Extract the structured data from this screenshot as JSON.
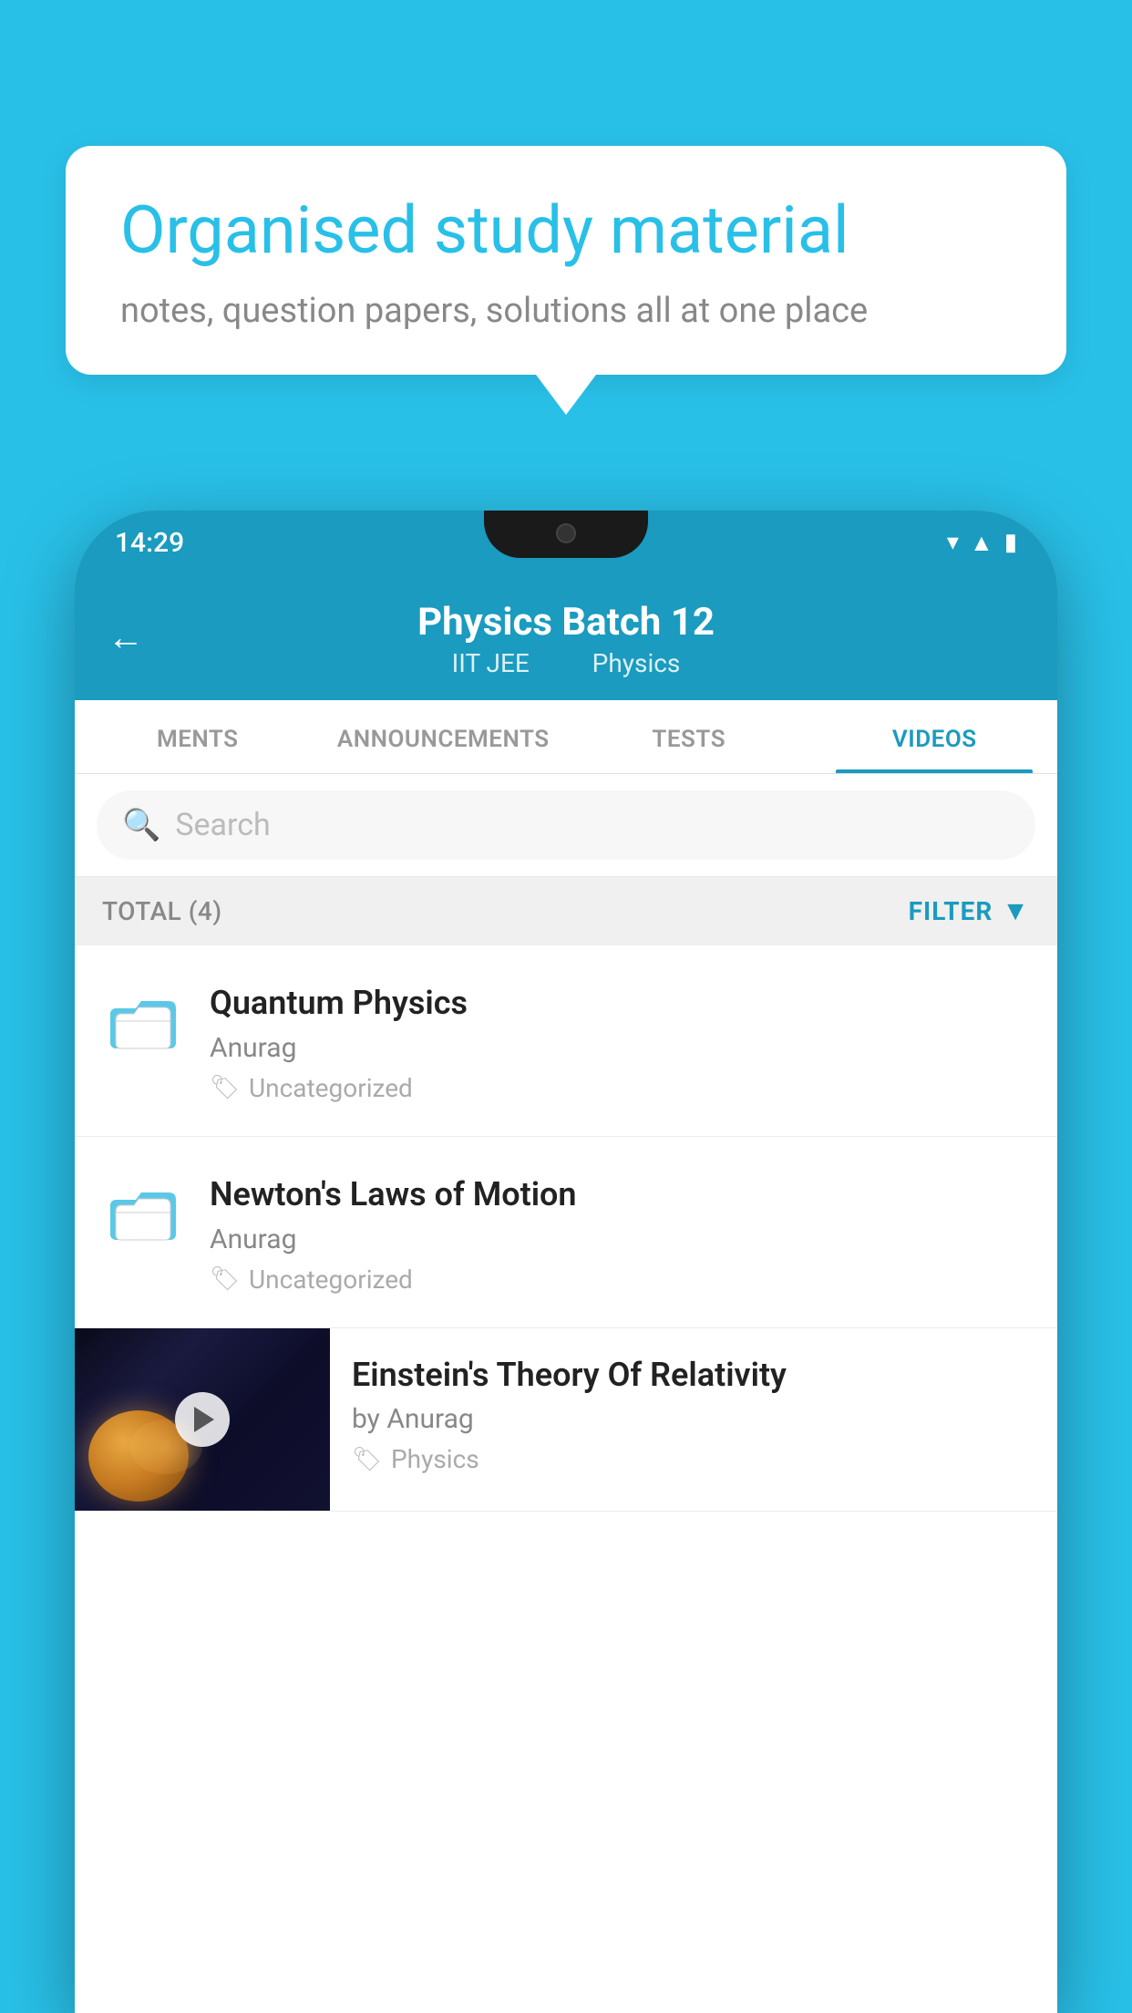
{
  "background_color": "#29C0E8",
  "bubble": {
    "title": "Organised study material",
    "subtitle": "notes, question papers, solutions all at one place"
  },
  "phone": {
    "status_bar": {
      "time": "14:29",
      "icons": [
        "wifi",
        "signal",
        "battery"
      ]
    },
    "header": {
      "back_label": "←",
      "title": "Physics Batch 12",
      "subtitle_left": "IIT JEE",
      "subtitle_right": "Physics"
    },
    "tabs": [
      {
        "label": "MENTS",
        "active": false
      },
      {
        "label": "ANNOUNCEMENTS",
        "active": false
      },
      {
        "label": "TESTS",
        "active": false
      },
      {
        "label": "VIDEOS",
        "active": true
      }
    ],
    "search": {
      "placeholder": "Search"
    },
    "filter_bar": {
      "total_label": "TOTAL (4)",
      "filter_label": "FILTER"
    },
    "videos": [
      {
        "id": 1,
        "title": "Quantum Physics",
        "author": "Anurag",
        "tag": "Uncategorized",
        "has_thumb": false
      },
      {
        "id": 2,
        "title": "Newton's Laws of Motion",
        "author": "Anurag",
        "tag": "Uncategorized",
        "has_thumb": false
      },
      {
        "id": 3,
        "title": "Einstein's Theory Of Relativity",
        "author": "by Anurag",
        "tag": "Physics",
        "has_thumb": true
      }
    ]
  }
}
